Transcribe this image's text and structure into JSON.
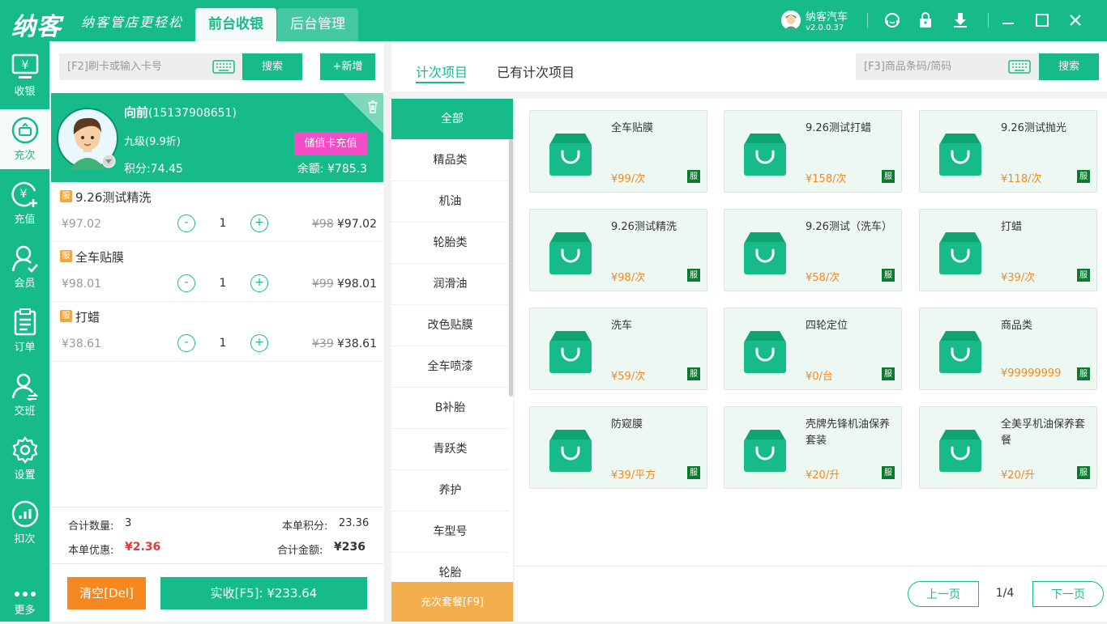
{
  "app": {
    "logo": "纳客",
    "slogan": "纳客管店更轻松"
  },
  "top_tabs": [
    {
      "label": "前台收银"
    },
    {
      "label": "后台管理"
    }
  ],
  "user": {
    "name": "纳客汽车",
    "version": "v2.0.0.37"
  },
  "sidebar": [
    {
      "label": "收银"
    },
    {
      "label": "充次"
    },
    {
      "label": "充值"
    },
    {
      "label": "会员"
    },
    {
      "label": "订单"
    },
    {
      "label": "交班"
    },
    {
      "label": "设置"
    },
    {
      "label": "扣次"
    },
    {
      "label": "更多"
    }
  ],
  "left": {
    "card_search_placeholder": "[F2]刷卡或输入卡号",
    "search_label": "搜索",
    "add_label": "+新增",
    "member": {
      "name": "向前",
      "phone": "(15137908651)",
      "level": "九级(9.9折)",
      "points": "积分:74.45",
      "recharge_label": "储值卡充值",
      "balance": "余额: ¥785.3"
    },
    "items": [
      {
        "badge": "服",
        "name": "9.26测试精洗",
        "price": "¥97.02",
        "qty": "1",
        "orig": "¥98",
        "final": "¥97.02"
      },
      {
        "badge": "服",
        "name": "全车贴膜",
        "price": "¥98.01",
        "qty": "1",
        "orig": "¥99",
        "final": "¥98.01"
      },
      {
        "badge": "服",
        "name": "打蜡",
        "price": "¥38.61",
        "qty": "1",
        "orig": "¥39",
        "final": "¥38.61"
      }
    ],
    "summary": {
      "total_qty_label": "合计数量:",
      "total_qty": "3",
      "points_label": "本单积分:",
      "points": "23.36",
      "discount_label": "本单优惠:",
      "discount": "¥2.36",
      "amount_label": "合计金额:",
      "amount": "¥236"
    },
    "clear_label": "清空[Del]",
    "pay_label": "实收[F5]: ¥233.64"
  },
  "right": {
    "tabs": [
      {
        "label": "计次项目"
      },
      {
        "label": "已有计次项目"
      }
    ],
    "search_placeholder": "[F3]商品条码/简码",
    "search_label": "搜索",
    "categories": [
      "全部",
      "精品类",
      "机油",
      "轮胎类",
      "润滑油",
      "改色贴膜",
      "全车喷漆",
      "B补胎",
      "青跃类",
      "养护",
      "车型号",
      "轮胎"
    ],
    "package_label": "充次套餐[F9]",
    "products": [
      {
        "name": "全车贴膜",
        "price": "¥99/次",
        "badge": "服"
      },
      {
        "name": "9.26测试打蜡",
        "price": "¥158/次",
        "badge": "服"
      },
      {
        "name": "9.26测试抛光",
        "price": "¥118/次",
        "badge": "服"
      },
      {
        "name": "9.26测试精洗",
        "price": "¥98/次",
        "badge": "服"
      },
      {
        "name": "9.26测试（洗车）",
        "price": "¥58/次",
        "badge": "服"
      },
      {
        "name": "打蜡",
        "price": "¥39/次",
        "badge": "服"
      },
      {
        "name": "洗车",
        "price": "¥59/次",
        "badge": "服"
      },
      {
        "name": "四轮定位",
        "price": "¥0/台",
        "badge": "服"
      },
      {
        "name": "商品类",
        "price": "¥99999999",
        "badge": "服"
      },
      {
        "name": "防窥膜",
        "price": "¥39/平方",
        "badge": "服"
      },
      {
        "name": "壳牌先锋机油保养套装",
        "price": "¥20/升",
        "badge": "服"
      },
      {
        "name": "全美孚机油保养套餐",
        "price": "¥20/升",
        "badge": "服"
      }
    ],
    "pager": {
      "prev": "上一页",
      "page": "1/4",
      "next": "下一页"
    }
  },
  "colors": {
    "brand": "#17bb8a",
    "accent_orange": "#f5881f",
    "pink": "#f24cc7",
    "discount_red": "#e53935"
  }
}
